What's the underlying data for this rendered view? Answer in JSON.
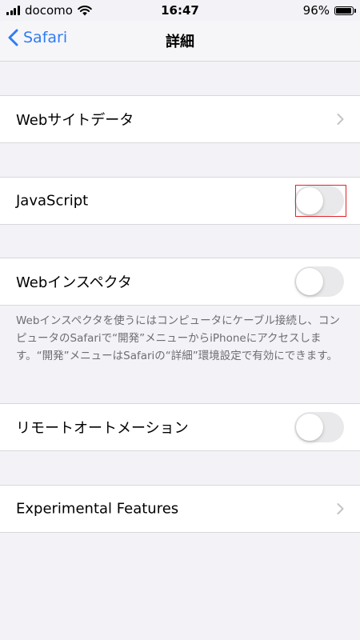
{
  "status_bar": {
    "carrier": "docomo",
    "time": "16:47",
    "battery": "96%",
    "battery_level": 0.96
  },
  "nav": {
    "back_label": "Safari",
    "title": "詳細"
  },
  "rows": {
    "website_data": {
      "label": "Webサイトデータ"
    },
    "javascript": {
      "label": "JavaScript",
      "enabled": false
    },
    "web_inspector": {
      "label": "Webインスペクタ",
      "enabled": false,
      "footer": "Webインスペクタを使うにはコンピュータにケーブル接続し、コンピュータのSafariで“開発”メニューからiPhoneにアクセスします。“開発”メニューはSafariの“詳細”環境設定で有効にできます。"
    },
    "remote_automation": {
      "label": "リモートオートメーション",
      "enabled": false
    },
    "experimental_features": {
      "label": "Experimental Features"
    }
  },
  "colors": {
    "accent": "#2f7cf6",
    "highlight": "#e0242b",
    "toggle_off": "#e9e9eb"
  }
}
